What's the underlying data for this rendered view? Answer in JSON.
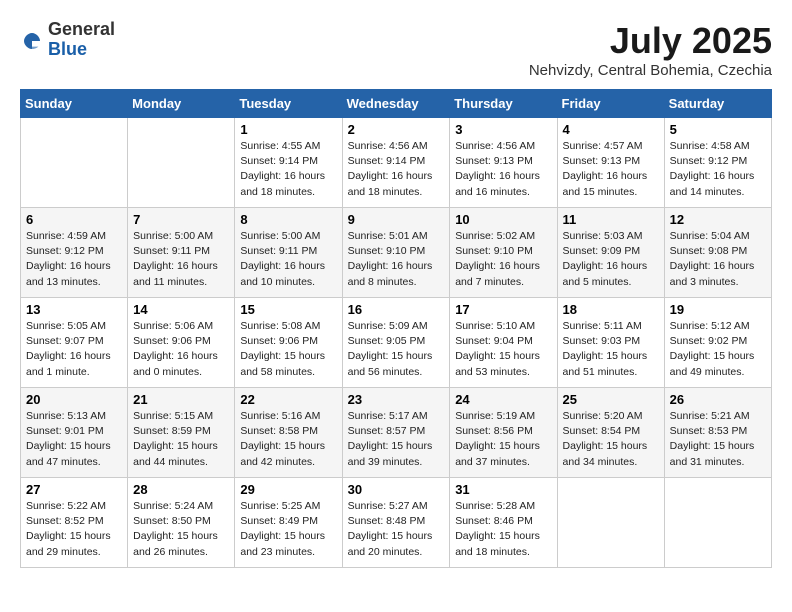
{
  "header": {
    "logo": {
      "line1": "General",
      "line2": "Blue"
    },
    "title": "July 2025",
    "location": "Nehvizdy, Central Bohemia, Czechia"
  },
  "columns": [
    "Sunday",
    "Monday",
    "Tuesday",
    "Wednesday",
    "Thursday",
    "Friday",
    "Saturday"
  ],
  "weeks": [
    [
      {
        "day": "",
        "info": ""
      },
      {
        "day": "",
        "info": ""
      },
      {
        "day": "1",
        "info": "Sunrise: 4:55 AM\nSunset: 9:14 PM\nDaylight: 16 hours and 18 minutes."
      },
      {
        "day": "2",
        "info": "Sunrise: 4:56 AM\nSunset: 9:14 PM\nDaylight: 16 hours and 18 minutes."
      },
      {
        "day": "3",
        "info": "Sunrise: 4:56 AM\nSunset: 9:13 PM\nDaylight: 16 hours and 16 minutes."
      },
      {
        "day": "4",
        "info": "Sunrise: 4:57 AM\nSunset: 9:13 PM\nDaylight: 16 hours and 15 minutes."
      },
      {
        "day": "5",
        "info": "Sunrise: 4:58 AM\nSunset: 9:12 PM\nDaylight: 16 hours and 14 minutes."
      }
    ],
    [
      {
        "day": "6",
        "info": "Sunrise: 4:59 AM\nSunset: 9:12 PM\nDaylight: 16 hours and 13 minutes."
      },
      {
        "day": "7",
        "info": "Sunrise: 5:00 AM\nSunset: 9:11 PM\nDaylight: 16 hours and 11 minutes."
      },
      {
        "day": "8",
        "info": "Sunrise: 5:00 AM\nSunset: 9:11 PM\nDaylight: 16 hours and 10 minutes."
      },
      {
        "day": "9",
        "info": "Sunrise: 5:01 AM\nSunset: 9:10 PM\nDaylight: 16 hours and 8 minutes."
      },
      {
        "day": "10",
        "info": "Sunrise: 5:02 AM\nSunset: 9:10 PM\nDaylight: 16 hours and 7 minutes."
      },
      {
        "day": "11",
        "info": "Sunrise: 5:03 AM\nSunset: 9:09 PM\nDaylight: 16 hours and 5 minutes."
      },
      {
        "day": "12",
        "info": "Sunrise: 5:04 AM\nSunset: 9:08 PM\nDaylight: 16 hours and 3 minutes."
      }
    ],
    [
      {
        "day": "13",
        "info": "Sunrise: 5:05 AM\nSunset: 9:07 PM\nDaylight: 16 hours and 1 minute."
      },
      {
        "day": "14",
        "info": "Sunrise: 5:06 AM\nSunset: 9:06 PM\nDaylight: 16 hours and 0 minutes."
      },
      {
        "day": "15",
        "info": "Sunrise: 5:08 AM\nSunset: 9:06 PM\nDaylight: 15 hours and 58 minutes."
      },
      {
        "day": "16",
        "info": "Sunrise: 5:09 AM\nSunset: 9:05 PM\nDaylight: 15 hours and 56 minutes."
      },
      {
        "day": "17",
        "info": "Sunrise: 5:10 AM\nSunset: 9:04 PM\nDaylight: 15 hours and 53 minutes."
      },
      {
        "day": "18",
        "info": "Sunrise: 5:11 AM\nSunset: 9:03 PM\nDaylight: 15 hours and 51 minutes."
      },
      {
        "day": "19",
        "info": "Sunrise: 5:12 AM\nSunset: 9:02 PM\nDaylight: 15 hours and 49 minutes."
      }
    ],
    [
      {
        "day": "20",
        "info": "Sunrise: 5:13 AM\nSunset: 9:01 PM\nDaylight: 15 hours and 47 minutes."
      },
      {
        "day": "21",
        "info": "Sunrise: 5:15 AM\nSunset: 8:59 PM\nDaylight: 15 hours and 44 minutes."
      },
      {
        "day": "22",
        "info": "Sunrise: 5:16 AM\nSunset: 8:58 PM\nDaylight: 15 hours and 42 minutes."
      },
      {
        "day": "23",
        "info": "Sunrise: 5:17 AM\nSunset: 8:57 PM\nDaylight: 15 hours and 39 minutes."
      },
      {
        "day": "24",
        "info": "Sunrise: 5:19 AM\nSunset: 8:56 PM\nDaylight: 15 hours and 37 minutes."
      },
      {
        "day": "25",
        "info": "Sunrise: 5:20 AM\nSunset: 8:54 PM\nDaylight: 15 hours and 34 minutes."
      },
      {
        "day": "26",
        "info": "Sunrise: 5:21 AM\nSunset: 8:53 PM\nDaylight: 15 hours and 31 minutes."
      }
    ],
    [
      {
        "day": "27",
        "info": "Sunrise: 5:22 AM\nSunset: 8:52 PM\nDaylight: 15 hours and 29 minutes."
      },
      {
        "day": "28",
        "info": "Sunrise: 5:24 AM\nSunset: 8:50 PM\nDaylight: 15 hours and 26 minutes."
      },
      {
        "day": "29",
        "info": "Sunrise: 5:25 AM\nSunset: 8:49 PM\nDaylight: 15 hours and 23 minutes."
      },
      {
        "day": "30",
        "info": "Sunrise: 5:27 AM\nSunset: 8:48 PM\nDaylight: 15 hours and 20 minutes."
      },
      {
        "day": "31",
        "info": "Sunrise: 5:28 AM\nSunset: 8:46 PM\nDaylight: 15 hours and 18 minutes."
      },
      {
        "day": "",
        "info": ""
      },
      {
        "day": "",
        "info": ""
      }
    ]
  ]
}
